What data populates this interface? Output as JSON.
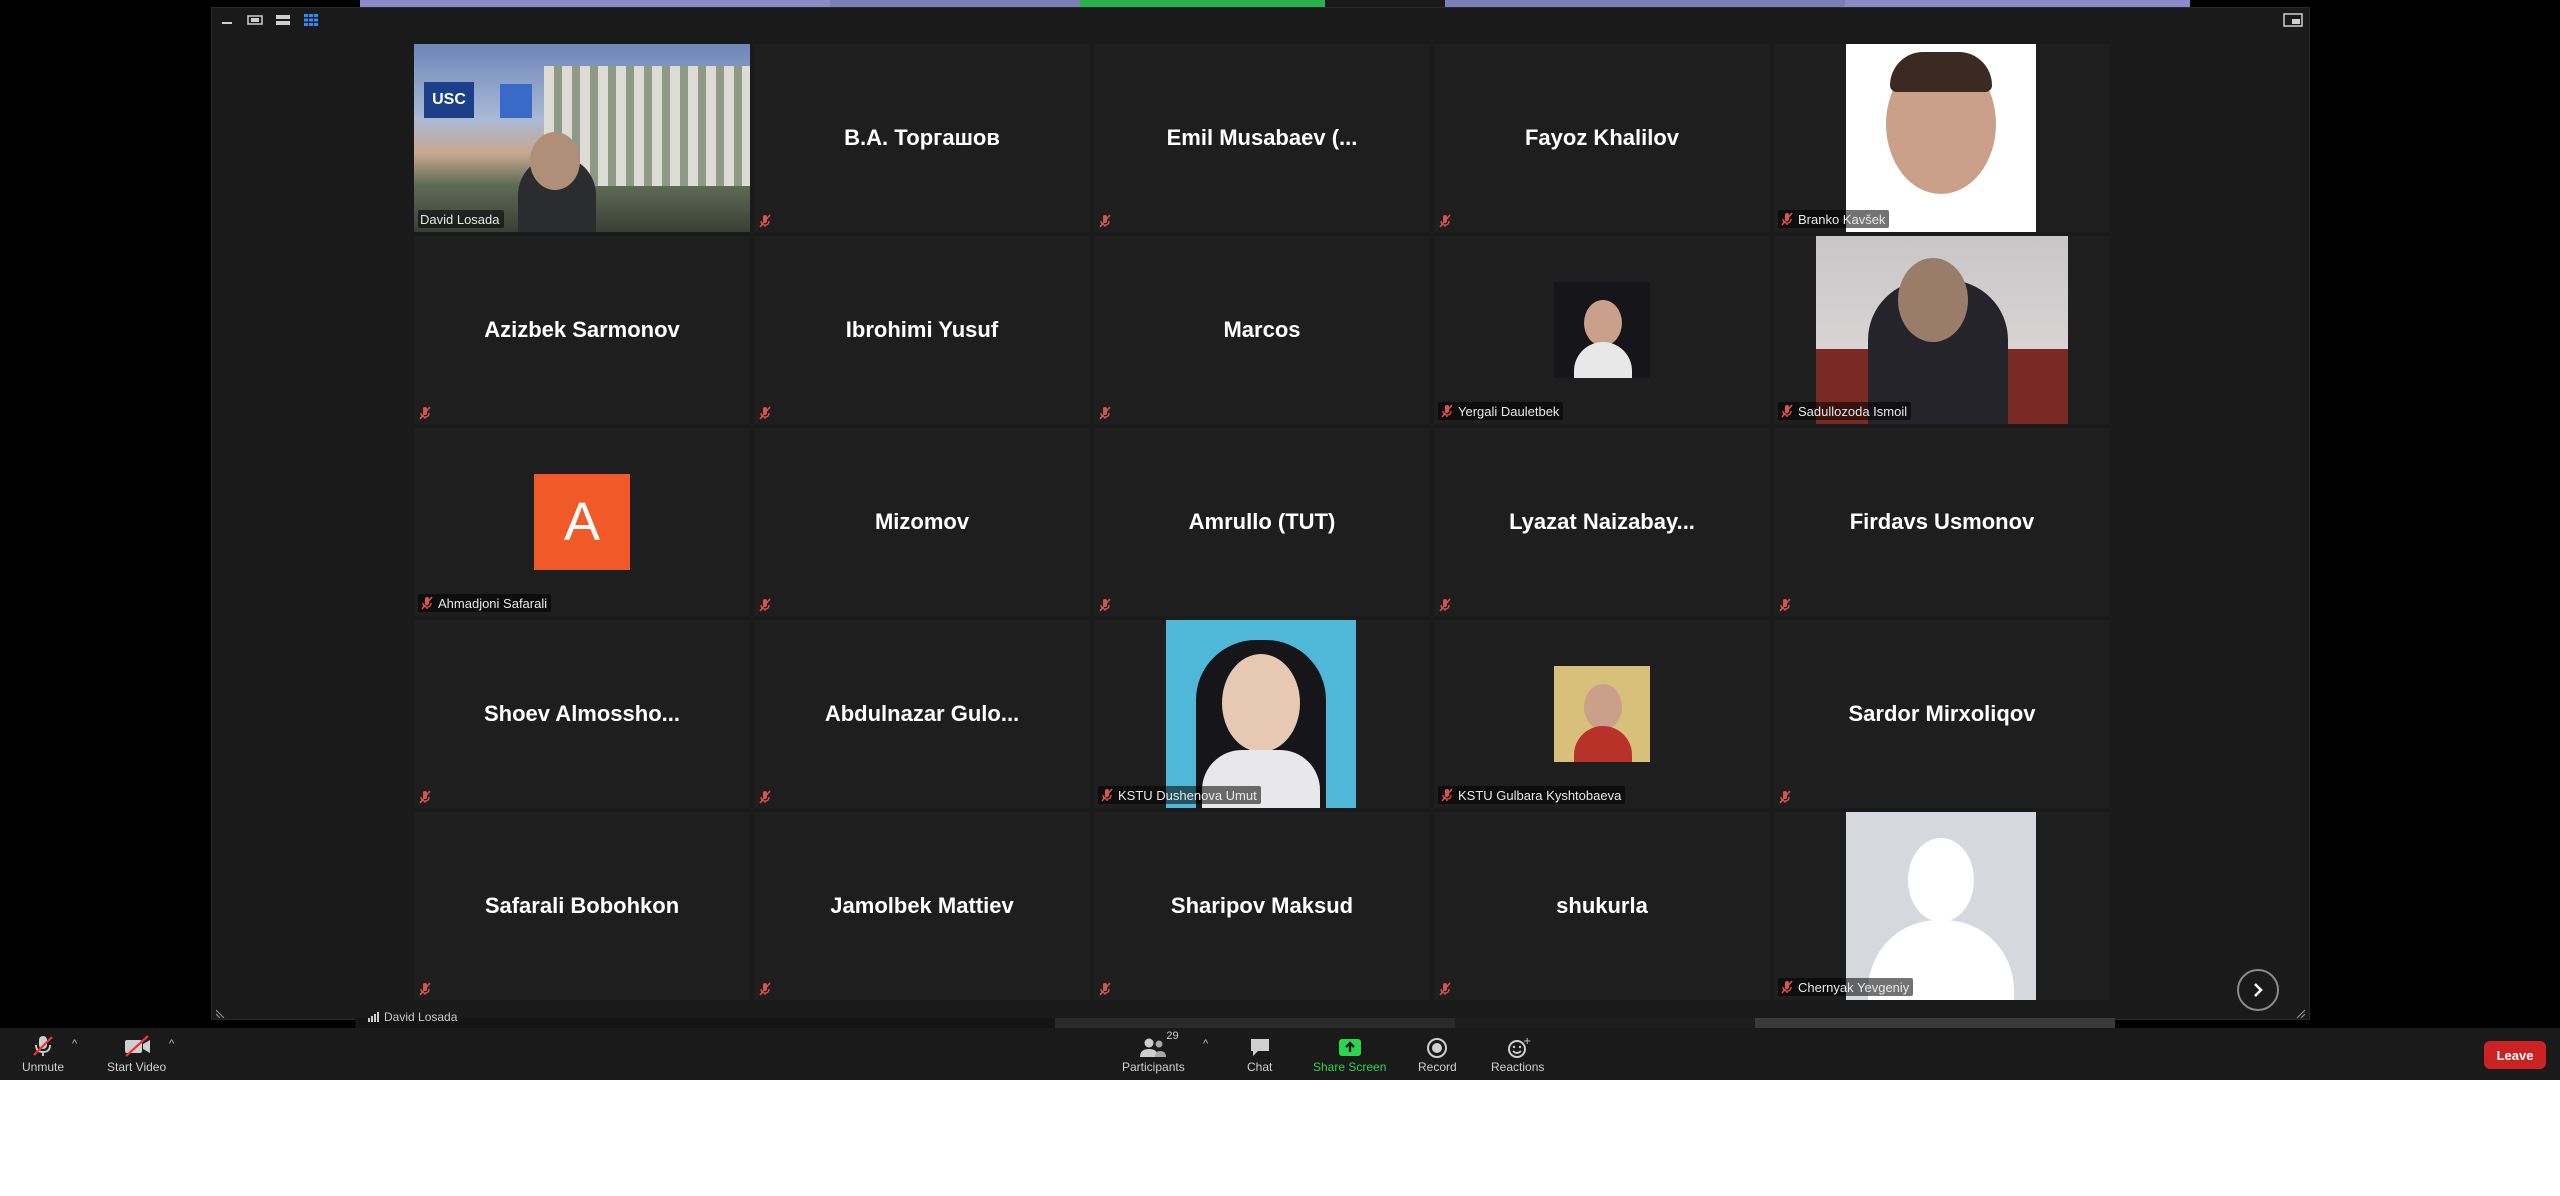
{
  "window": {
    "view_buttons": [
      "minimize-icon",
      "speaker-view-icon",
      "gallery-view-icon",
      "grid-view-icon"
    ],
    "exit_fullscreen_icon": "exit-fullscreen-icon"
  },
  "top_strip_colors": [
    "#8a8bc8",
    "#7b7fb8",
    "#2bb24c",
    "#1a1a1a",
    "#7b7fb8",
    "#8a8bc8"
  ],
  "tiles": [
    {
      "name": "David Losada",
      "display": "video",
      "label": "David Losada",
      "active": true,
      "muted": true
    },
    {
      "name": "B.A. Торгашов",
      "display": "name",
      "muted": true
    },
    {
      "name": "Emil Musabaev (...",
      "display": "name",
      "muted": true
    },
    {
      "name": "Fayoz Khalilov",
      "display": "name",
      "muted": true
    },
    {
      "name": "Branko Kavšek",
      "display": "photo",
      "label": "Branko Kavšek",
      "muted": true
    },
    {
      "name": "Azizbek Sarmonov",
      "display": "name",
      "muted": true
    },
    {
      "name": "Ibrohimi Yusuf",
      "display": "name",
      "muted": true
    },
    {
      "name": "Marcos",
      "display": "name",
      "muted": true
    },
    {
      "name": "Yergali Dauletbek",
      "display": "photo-small",
      "label": "Yergali Dauletbek",
      "muted": true
    },
    {
      "name": "Sadullozoda Ismoil",
      "display": "video",
      "label": "Sadullozoda Ismoil",
      "muted": true
    },
    {
      "name": "Ahmadjoni Safarali",
      "display": "avatar",
      "avatar_letter": "A",
      "avatar_color": "#f05a28",
      "label": "Ahmadjoni Safarali",
      "muted": true
    },
    {
      "name": "Mizomov",
      "display": "name",
      "muted": true
    },
    {
      "name": "Amrullo (TUT)",
      "display": "name",
      "muted": true
    },
    {
      "name": "Lyazat Naizabay...",
      "display": "name",
      "muted": true
    },
    {
      "name": "Firdavs Usmonov",
      "display": "name",
      "muted": true
    },
    {
      "name": "Shoev Almossho...",
      "display": "name",
      "muted": true
    },
    {
      "name": "Abdulnazar Gulo...",
      "display": "name",
      "muted": true
    },
    {
      "name": "KSTU Dushenova Umut",
      "display": "photo",
      "label": "KSTU Dushenova Umut",
      "muted": true
    },
    {
      "name": "KSTU Gulbara Kyshtobaeva",
      "display": "photo-small",
      "label": "KSTU Gulbara Kyshtobaeva",
      "muted": true
    },
    {
      "name": "Sardor Mirxoliqov",
      "display": "name",
      "muted": true
    },
    {
      "name": "Safarali Bobohkon",
      "display": "name",
      "muted": true
    },
    {
      "name": "Jamolbek Mattiev",
      "display": "name",
      "muted": true
    },
    {
      "name": "Sharipov Maksud",
      "display": "name",
      "muted": true
    },
    {
      "name": "shukurla",
      "display": "name",
      "muted": true
    },
    {
      "name": "Chernyak Yevgeniy",
      "display": "placeholder",
      "label": "Chernyak Yevgeniy",
      "muted": true
    }
  ],
  "grid_nav": {
    "next_icon": "chevron-right-icon"
  },
  "below_strip_label": "David Losada",
  "toolbar": {
    "unmute_label": "Unmute",
    "start_video_label": "Start Video",
    "participants_label": "Participants",
    "participants_count": "29",
    "chat_label": "Chat",
    "share_screen_label": "Share Screen",
    "record_label": "Record",
    "reactions_label": "Reactions",
    "leave_label": "Leave",
    "accent_green": "#2bd44f",
    "leave_color": "#cc2222"
  }
}
